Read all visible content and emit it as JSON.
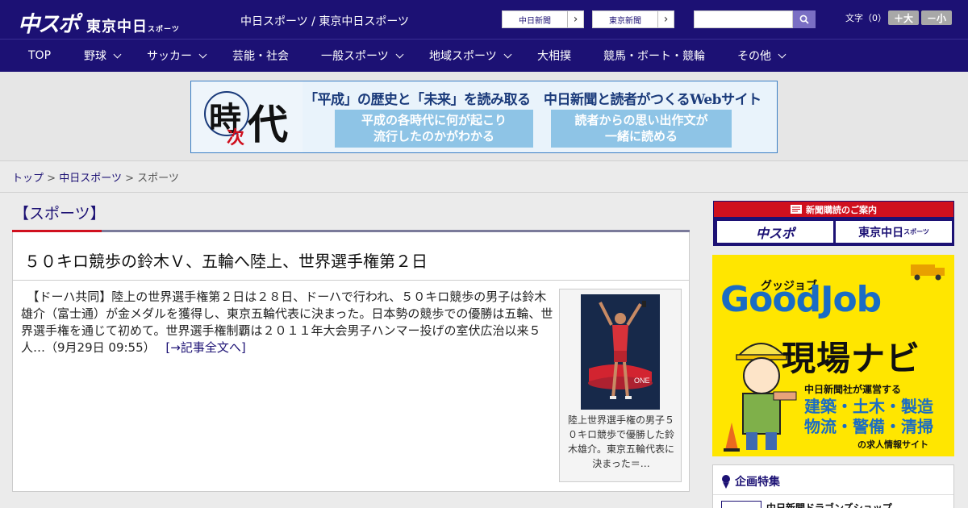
{
  "header": {
    "logo_main": "中スポ",
    "logo_sub": "東京中日",
    "logo_sub_small": "スポーツ",
    "site_link": "中日スポーツ / 東京中日スポーツ",
    "paper_buttons": [
      {
        "label": "中日新聞",
        "arrow": "›"
      },
      {
        "label": "東京新聞",
        "arrow": "›"
      }
    ],
    "search_placeholder": "",
    "fontsize_label": "文字（0）",
    "fontsize_large": "＋大",
    "fontsize_small": "－小"
  },
  "nav": [
    {
      "label": "TOP",
      "dropdown": false
    },
    {
      "label": "野球",
      "dropdown": true
    },
    {
      "label": "サッカー",
      "dropdown": true
    },
    {
      "label": "芸能・社会",
      "dropdown": false
    },
    {
      "label": "一般スポーツ",
      "dropdown": true
    },
    {
      "label": "地域スポーツ",
      "dropdown": true
    },
    {
      "label": "大相撲",
      "dropdown": false
    },
    {
      "label": "競馬・ボート・競輪",
      "dropdown": false
    },
    {
      "label": "その他",
      "dropdown": true
    }
  ],
  "banner": {
    "kanji_1": "時",
    "kanji_2": "次",
    "kanji_3": "代",
    "headline": "「平成」の歴史と「未来」を読み取る　中日新聞と読者がつくるWebサイト",
    "box1_line1": "平成の各時代に何が起こり",
    "box1_line2": "流行したのかがわかる",
    "box2_line1": "読者からの思い出作文が",
    "box2_line2": "一緒に読める"
  },
  "breadcrumb": {
    "top": "トップ",
    "sep": ">",
    "chunichi": "中日スポーツ",
    "current": "スポーツ"
  },
  "section": {
    "title": "【スポーツ】"
  },
  "article": {
    "title": "５０キロ競歩の鈴木Ｖ、五輪へ陸上、世界選手権第２日",
    "body": "　【ドーハ共同】陸上の世界選手権第２日は２８日、ドーハで行われ、５０キロ競歩の男子は鈴木雄介（富士通）が金メダルを獲得し、東京五輪代表に決まった。日本勢の競歩での優勝は五輪、世界選手権を通じて初めて。世界選手権制覇は２０１１年大会男子ハンマー投げの室伏広治以来５人…（9月29日 09:55）",
    "more_link": "[→記事全文へ]",
    "photo_caption": "陸上世界選手権の男子５０キロ競歩で優勝した鈴木雄介。東京五輪代表に決まった＝…"
  },
  "sidebar": {
    "subscribe_title": "新聞購読のご案内",
    "subscribe_a": "中スポ",
    "subscribe_b": "東京中日",
    "subscribe_b_small": "スポーツ",
    "goodjob_kana": "グッジョブ",
    "goodjob_title": "GoodJob",
    "goodjob_genba": "現場ナビ",
    "goodjob_sub": "中日新聞社が運営する",
    "goodjob_cats_1": "建築・土木・製造",
    "goodjob_cats_2": "物流・警備・清掃",
    "goodjob_foot": "の求人情報サイト",
    "kikaku_title": "企画特集",
    "kikaku_item": "中日新聞ドラゴンズショップ"
  },
  "colors": {
    "brand": "#1c1174",
    "accent_red": "#d0101e",
    "goodjob_yellow": "#ffe600",
    "goodjob_blue": "#1a6cc4"
  }
}
